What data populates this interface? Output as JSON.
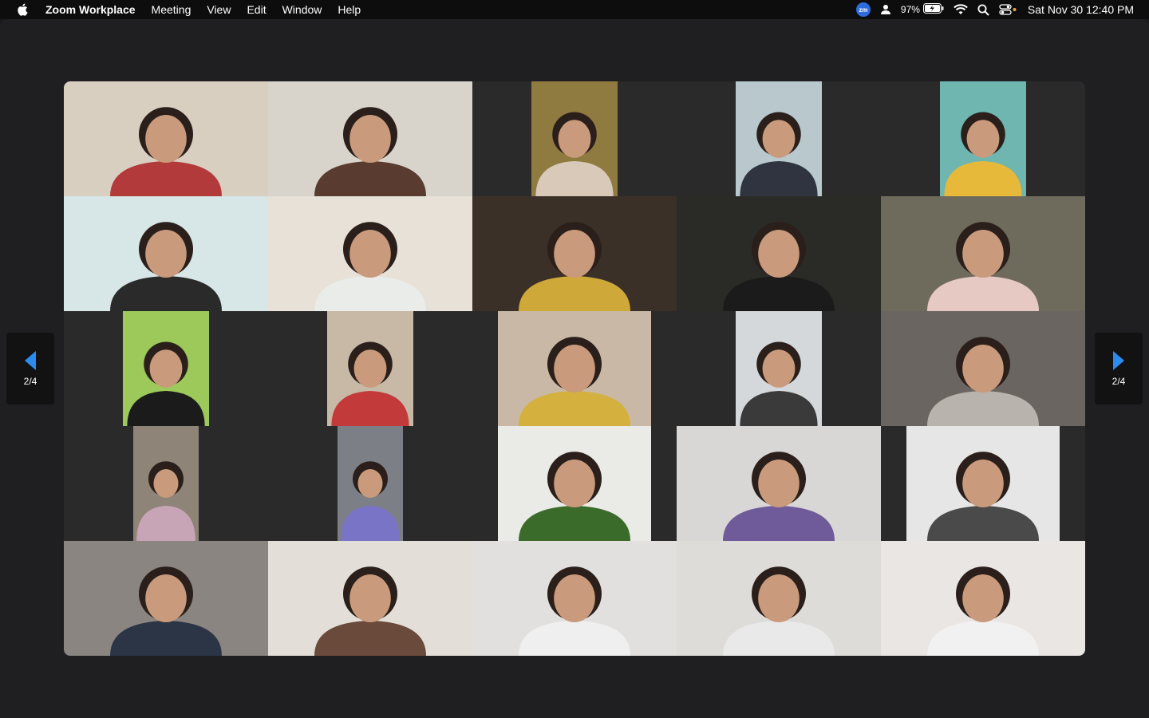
{
  "menubar": {
    "apple_icon": "apple-logo-icon",
    "items": [
      "Zoom Workplace",
      "Meeting",
      "View",
      "Edit",
      "Window",
      "Help"
    ],
    "zoom_badge": "zm",
    "battery_percent": "97%",
    "clock": "Sat Nov 30  12:40 PM"
  },
  "pager": {
    "prev_label": "2/4",
    "next_label": "2/4",
    "arrow_color": "#2b8cf0"
  },
  "participants": [
    {
      "bg": "#d9cfc0",
      "fg": "#b23a3a"
    },
    {
      "bg": "#d8d4cc",
      "fg": "#5a3b2f"
    },
    {
      "bg": "#8f7a40",
      "fg": "#d9c9b8"
    },
    {
      "bg": "#b9c8cc",
      "fg": "#2f3440"
    },
    {
      "bg": "#6fb5b0",
      "fg": "#e6b93a"
    },
    {
      "bg": "#d7e6e6",
      "fg": "#2a2a2a"
    },
    {
      "bg": "#e7e1d7",
      "fg": "#e9ece8"
    },
    {
      "bg": "#3b3028",
      "fg": "#cfa83a"
    },
    {
      "bg": "#2a2a26",
      "fg": "#1b1b1b"
    },
    {
      "bg": "#6e6a5c",
      "fg": "#e7c9c3"
    },
    {
      "bg": "#9cc95a",
      "fg": "#1b1b1b"
    },
    {
      "bg": "#c7b9a6",
      "fg": "#c33a3a"
    },
    {
      "bg": "#c9b8a6",
      "fg": "#d4b13e"
    },
    {
      "bg": "#d5d8da",
      "fg": "#3a3a3a"
    },
    {
      "bg": "#6a6560",
      "fg": "#b9b3ad"
    },
    {
      "bg": "#8e8478",
      "fg": "#c7a4b6"
    },
    {
      "bg": "#7c7f86",
      "fg": "#7a74c6"
    },
    {
      "bg": "#eaeae6",
      "fg": "#3b6b2a"
    },
    {
      "bg": "#d9d6d6",
      "fg": "#6f5a9a"
    },
    {
      "bg": "#e6e6e6",
      "fg": "#4a4a4a"
    },
    {
      "bg": "#8a8580",
      "fg": "#2b3546"
    },
    {
      "bg": "#e3dfd8",
      "fg": "#6a4a3a"
    },
    {
      "bg": "#e2e0de",
      "fg": "#efefef"
    },
    {
      "bg": "#dedcd9",
      "fg": "#e9e9e9"
    },
    {
      "bg": "#e9e6e3",
      "fg": "#f1f1f1"
    }
  ]
}
